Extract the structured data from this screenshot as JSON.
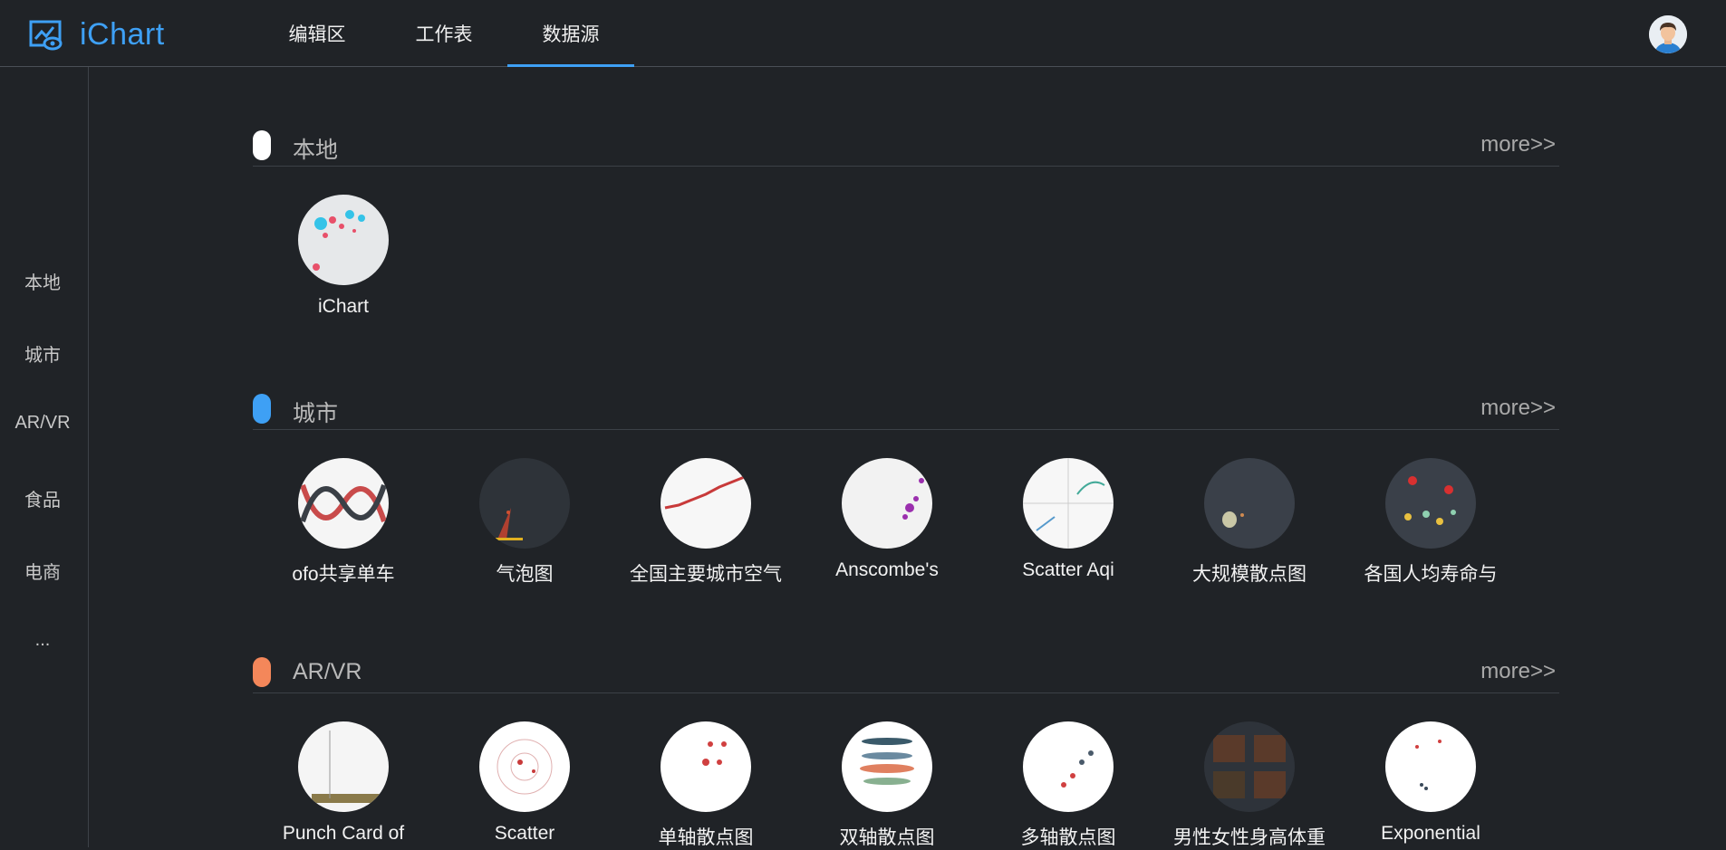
{
  "app": {
    "title": "iChart"
  },
  "nav": {
    "tabs": [
      {
        "label": "编辑区"
      },
      {
        "label": "工作表"
      },
      {
        "label": "数据源"
      }
    ]
  },
  "sidebar": {
    "items": [
      {
        "label": "本地"
      },
      {
        "label": "城市"
      },
      {
        "label": "AR/VR"
      },
      {
        "label": "食品"
      },
      {
        "label": "电商"
      },
      {
        "label": "..."
      }
    ]
  },
  "sections": [
    {
      "title": "本地",
      "more": "more>>",
      "pill_color": "#ffffff",
      "cards": [
        {
          "label": "iChart"
        }
      ]
    },
    {
      "title": "城市",
      "more": "more>>",
      "pill_color": "#3ea0f5",
      "cards": [
        {
          "label": "ofo共享单车"
        },
        {
          "label": "气泡图"
        },
        {
          "label": "全国主要城市空气"
        },
        {
          "label": "Anscombe's"
        },
        {
          "label": "Scatter Aqi"
        },
        {
          "label": "大规模散点图"
        },
        {
          "label": "各国人均寿命与"
        }
      ]
    },
    {
      "title": "AR/VR",
      "more": "more>>",
      "pill_color": "#f4875a",
      "cards": [
        {
          "label": "Punch Card of"
        },
        {
          "label": "Scatter"
        },
        {
          "label": "单轴散点图"
        },
        {
          "label": "双轴散点图"
        },
        {
          "label": "多轴散点图"
        },
        {
          "label": "男性女性身高体重"
        },
        {
          "label": "Exponential"
        }
      ]
    }
  ]
}
